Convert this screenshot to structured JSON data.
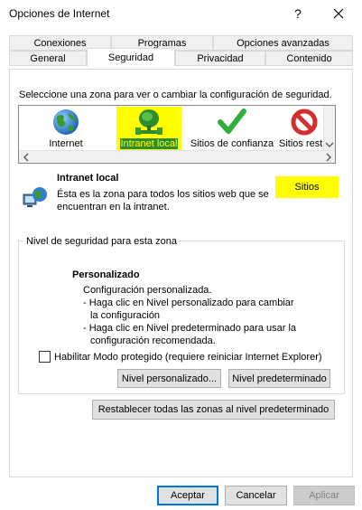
{
  "window": {
    "title": "Opciones de Internet",
    "help_glyph": "?",
    "close_glyph": "✕"
  },
  "tabs": {
    "row1": [
      "Conexiones",
      "Programas",
      "Opciones avanzadas"
    ],
    "row2": [
      "General",
      "Seguridad",
      "Privacidad",
      "Contenido"
    ],
    "selected": "Seguridad"
  },
  "zone_section": {
    "instruction": "Seleccione una zona para ver o cambiar la configuración de seguridad.",
    "zones": [
      {
        "label": "Internet",
        "icon": "globe-icon"
      },
      {
        "label": "Intranet local",
        "icon": "intranet-icon",
        "selected": true
      },
      {
        "label": "Sitios de confianza",
        "icon": "checkmark-icon"
      },
      {
        "label": "Sitios rest",
        "icon": "restricted-icon"
      }
    ],
    "highlight_color": "#ffff00"
  },
  "zone_detail": {
    "title": "Intranet local",
    "description_line1": "Ésta es la zona para todos los sitios web que se",
    "description_line2": "encuentran en la intranet.",
    "sites_button": "Sitios"
  },
  "security_level": {
    "group_label": "Nivel de seguridad para esta zona",
    "level_title": "Personalizado",
    "lines": [
      "Configuración personalizada.",
      "- Haga clic en Nivel personalizado para cambiar",
      "  la configuración",
      "- Haga clic en Nivel predeterminado para usar la",
      "  configuración recomendada."
    ],
    "protected_mode_label": "Habilitar Modo protegido (requiere reiniciar Internet Explorer)",
    "protected_mode_checked": false,
    "custom_level_button": "Nivel personalizado...",
    "default_level_button": "Nivel predeterminado"
  },
  "reset_all_button": "Restablecer todas las zonas al nivel predeterminado",
  "footer": {
    "accept": "Aceptar",
    "cancel": "Cancelar",
    "apply": "Aplicar"
  }
}
